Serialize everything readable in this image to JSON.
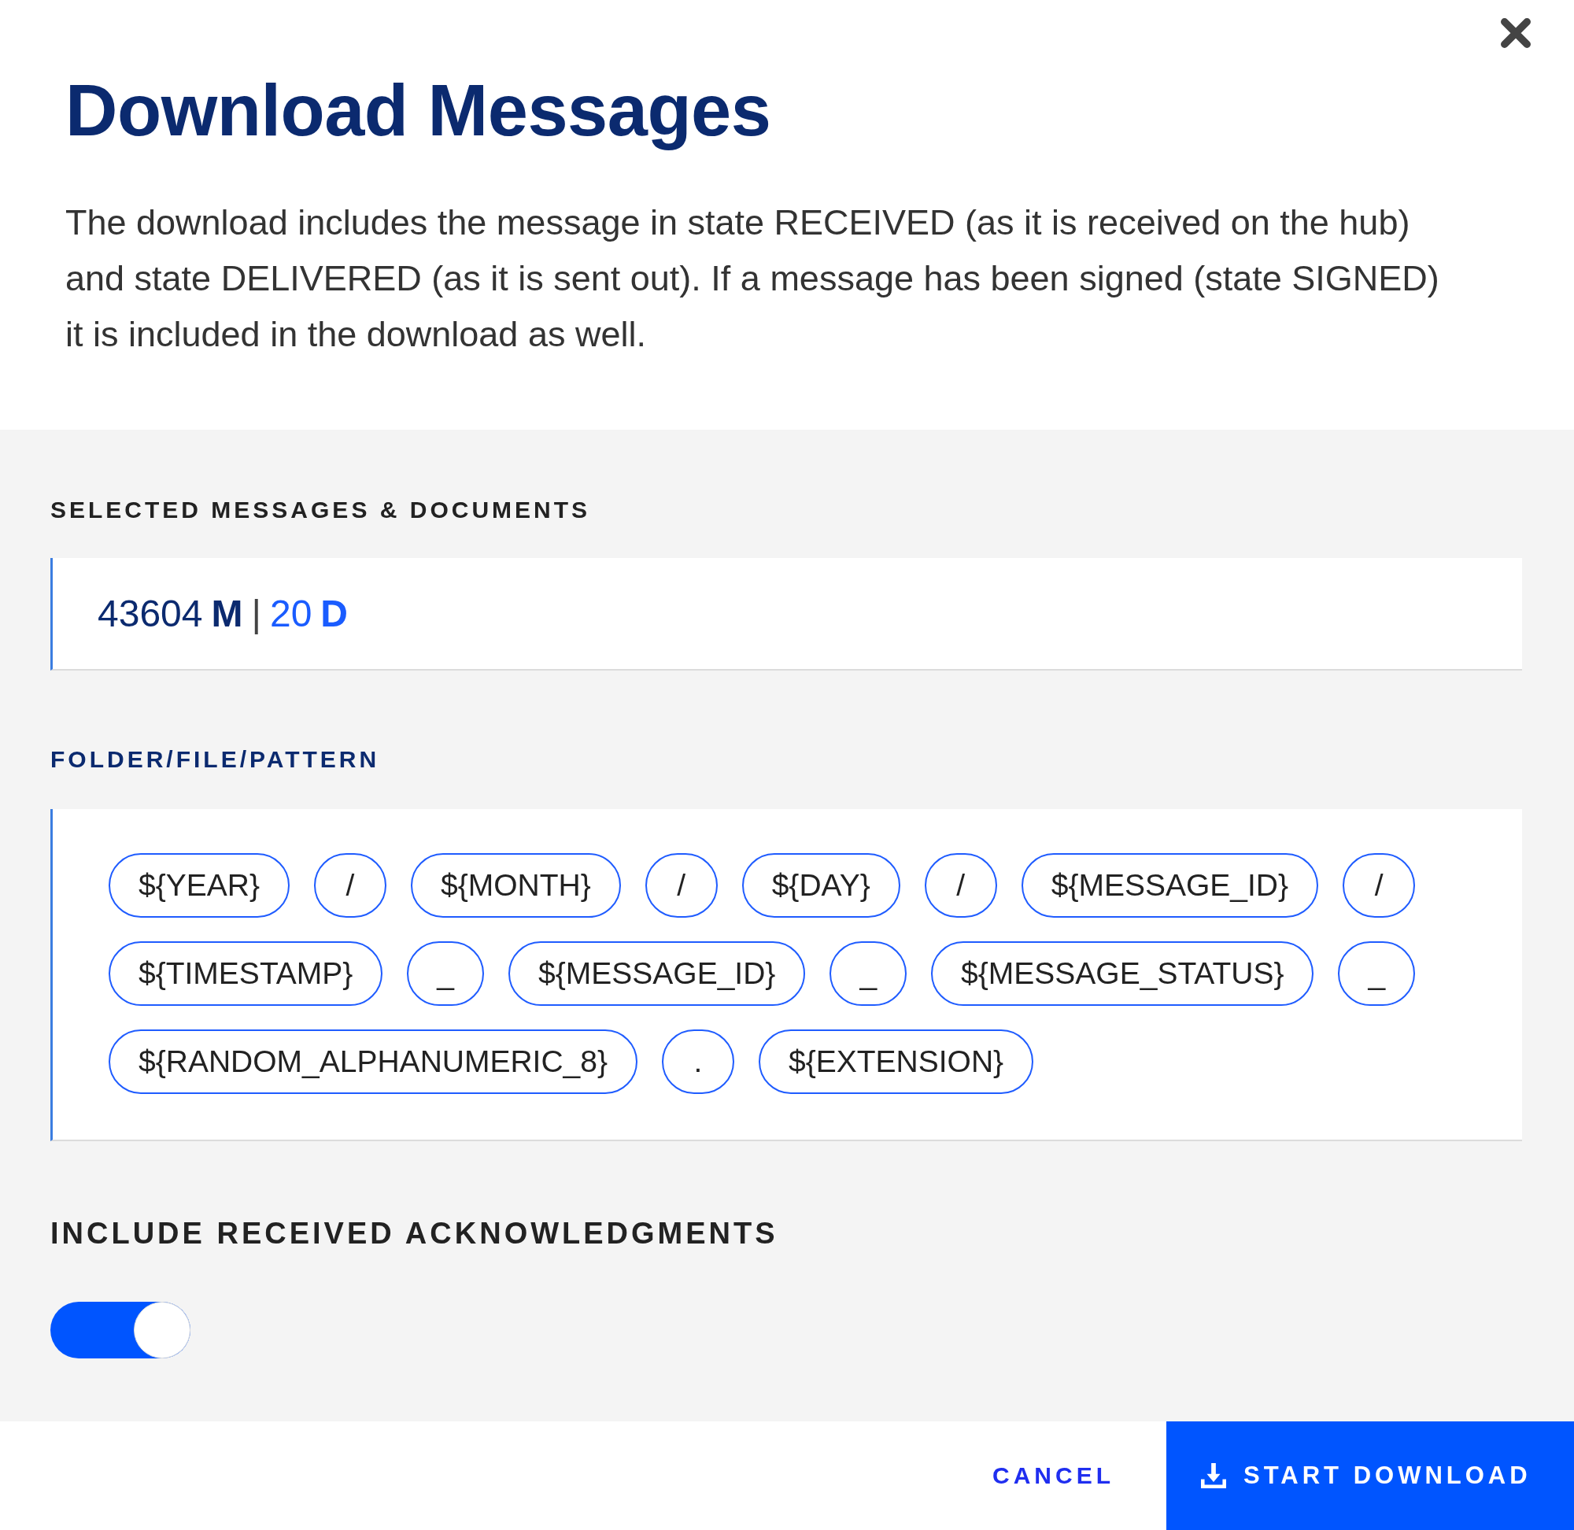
{
  "dialog": {
    "title": "Download Messages",
    "description": "The download includes the message in state RECEIVED (as it is received on the hub) and state DELIVERED (as it is sent out). If a message has been signed (state SIGNED) it is included in the download as well."
  },
  "selection": {
    "label": "SELECTED MESSAGES & DOCUMENTS",
    "focused": false,
    "messages_count": "43604",
    "messages_unit": "M",
    "separator": "|",
    "documents_count": "20",
    "documents_unit": "D"
  },
  "pattern": {
    "label": "FOLDER/FILE/PATTERN",
    "focused": true,
    "tokens": [
      "${YEAR}",
      "/",
      "${MONTH}",
      "/",
      "${DAY}",
      "/",
      "${MESSAGE_ID}",
      "/",
      "${TIMESTAMP}",
      "_",
      "${MESSAGE_ID}",
      "_",
      "${MESSAGE_STATUS}",
      "_",
      "${RANDOM_ALPHANUMERIC_8}",
      ".",
      "${EXTENSION}"
    ]
  },
  "acknowledgments": {
    "label": "INCLUDE RECEIVED ACKNOWLEDGMENTS",
    "on": true
  },
  "buttons": [
    {
      "label": "CANCEL",
      "kind": "text"
    },
    {
      "label": "START DOWNLOAD",
      "kind": "primary"
    }
  ]
}
